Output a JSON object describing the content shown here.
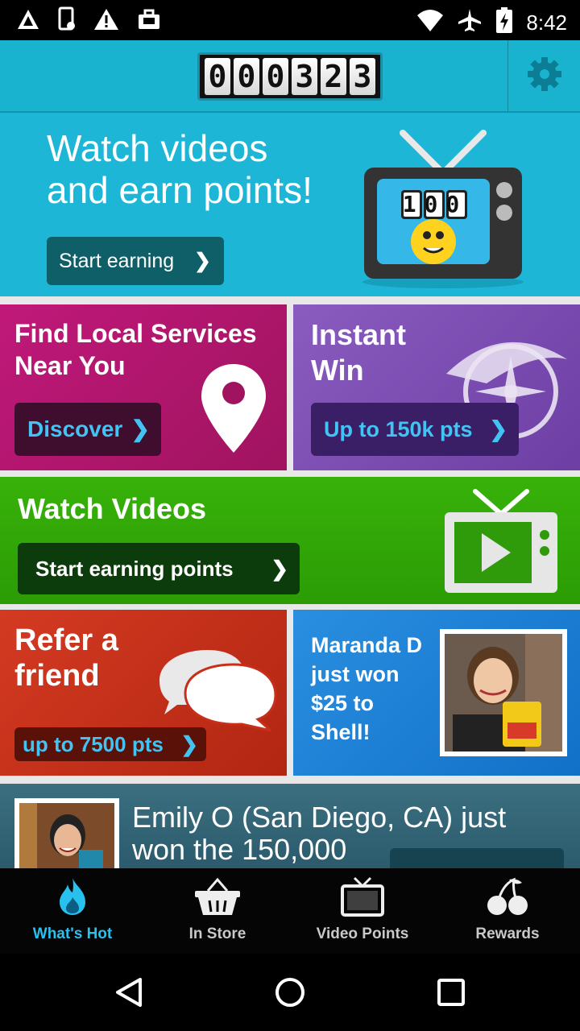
{
  "status_bar": {
    "time": "8:42",
    "left_icons": [
      "app-a-icon",
      "phone-icon",
      "warning-icon",
      "briefcase-icon"
    ],
    "right_icons": [
      "wifi-icon",
      "airplane-icon",
      "battery-charging-icon"
    ]
  },
  "header": {
    "counter_digits": [
      "0",
      "0",
      "0",
      "3",
      "2",
      "3"
    ],
    "settings_icon": "gear-icon"
  },
  "hero": {
    "headline_line1": "Watch videos",
    "headline_line2": "and earn points!",
    "cta_label": "Start earning",
    "tv_counter": "100"
  },
  "tiles": {
    "services": {
      "title_line1": "Find Local Services",
      "title_line2": "Near You",
      "button": "Discover"
    },
    "instant": {
      "title_line1": "Instant",
      "title_line2": "Win",
      "button": "Up to 150k pts"
    },
    "watch": {
      "title": "Watch Videos",
      "button": "Start earning points"
    },
    "refer": {
      "title_line1": "Refer a",
      "title_line2": "friend",
      "button": "up to 7500 pts"
    },
    "winner": {
      "line1": "Maranda D",
      "line2": "just won",
      "line3": "$25 to",
      "line4": "Shell!"
    },
    "emily": {
      "line1": "Emily O (San Diego, CA) just",
      "line2": "won the 150,000"
    }
  },
  "bottom_nav": [
    {
      "label": "What's Hot",
      "icon": "flame-icon",
      "active": true
    },
    {
      "label": "In Store",
      "icon": "basket-icon",
      "active": false
    },
    {
      "label": "Video Points",
      "icon": "tv-icon",
      "active": false
    },
    {
      "label": "Rewards",
      "icon": "cherries-icon",
      "active": false
    }
  ],
  "colors": {
    "header": "#19b3cf",
    "hero": "#1db6d6",
    "services": "#c0187a",
    "instant": "#7b4bb3",
    "watch": "#33a808",
    "refer": "#c72f1a",
    "winner": "#1f80d6",
    "nav_active": "#28c0ec"
  }
}
